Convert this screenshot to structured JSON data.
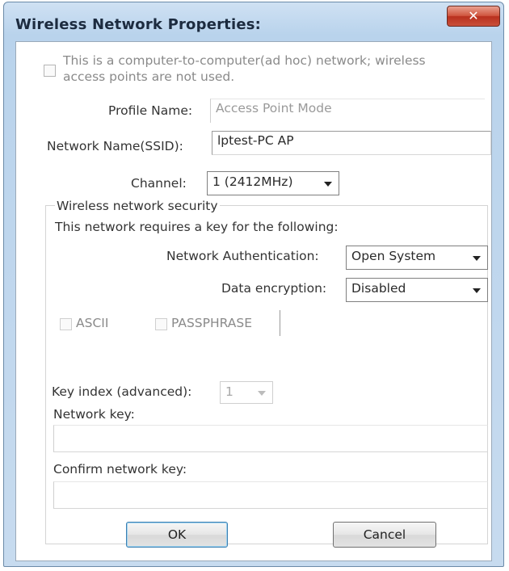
{
  "window": {
    "title": "Wireless Network Properties:",
    "close_glyph": "✕"
  },
  "adhoc": {
    "label_line1": "This is a computer-to-computer(ad hoc) network; wireless",
    "label_line2": "access points are not used.",
    "checked": false
  },
  "profile": {
    "label": "Profile Name:",
    "value": "Access Point Mode"
  },
  "ssid": {
    "label": "Network Name(SSID):",
    "value": "lptest-PC  AP"
  },
  "channel": {
    "label": "Channel:",
    "value": "1  (2412MHz)"
  },
  "security": {
    "group_title": "Wireless network security",
    "requires_text": "This network requires a key for the following:",
    "auth_label": "Network Authentication:",
    "auth_value": "Open System",
    "enc_label": "Data encryption:",
    "enc_value": "Disabled",
    "ascii_label": "ASCII",
    "passphrase_label": "PASSPHRASE",
    "key_index_label": "Key index (advanced):",
    "key_index_value": "1",
    "network_key_label": "Network key:",
    "network_key_value": "",
    "confirm_key_label": "Confirm network key:",
    "confirm_key_value": ""
  },
  "buttons": {
    "ok": "OK",
    "cancel": "Cancel"
  }
}
